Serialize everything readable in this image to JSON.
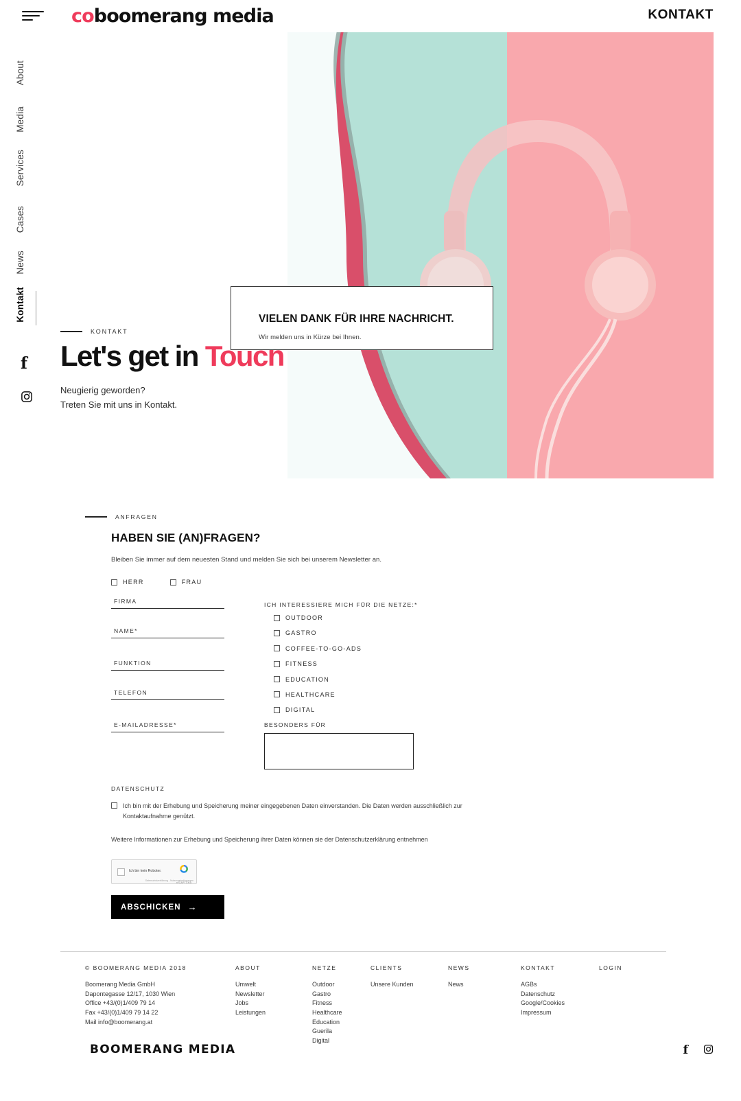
{
  "topbar": {
    "menu_icon": "hamburger-icon",
    "brand": "boomerang media",
    "brand_mark": "co",
    "brand_rest": "boomerang media",
    "right_link": "KONTAKT"
  },
  "rail": {
    "items": [
      {
        "label": "About",
        "active": false
      },
      {
        "label": "Media",
        "active": false
      },
      {
        "label": "Services",
        "active": false
      },
      {
        "label": "Cases",
        "active": false
      },
      {
        "label": "News",
        "active": false
      },
      {
        "label": "Kontakt",
        "active": true
      }
    ],
    "social": [
      {
        "name": "facebook-icon",
        "glyph": "f"
      },
      {
        "name": "instagram-icon",
        "glyph": "instagram"
      }
    ]
  },
  "modal": {
    "title": "VIELEN DANK FÜR IHRE NACHRICHT.",
    "subtitle": "Wir melden uns in Kürze bei Ihnen."
  },
  "hero": {
    "eyebrow": "KONTAKT",
    "headline_black": "Let's get in ",
    "headline_accent": "Touch",
    "sub_line1": "Neugierig geworden?",
    "sub_line2": "Treten Sie mit uns in Kontakt.",
    "image_alt": "headphones-photo"
  },
  "form": {
    "eyebrow": "ANFRAGEN",
    "title": "HABEN SIE (AN)FRAGEN?",
    "description": "Bleiben Sie immer auf dem neuesten Stand und melden Sie sich bei unserem Newsletter an.",
    "salutation": [
      {
        "label": "HERR",
        "checked": false
      },
      {
        "label": "FRAU",
        "checked": false
      }
    ],
    "fields": [
      {
        "label": "FIRMA",
        "value": "",
        "required": false
      },
      {
        "label": "NAME*",
        "value": "",
        "required": true
      },
      {
        "label": "FUNKTION",
        "value": "",
        "required": false
      },
      {
        "label": "TELEFON",
        "value": "",
        "required": false
      },
      {
        "label": "E-MAILADRESSE*",
        "value": "",
        "required": true
      }
    ],
    "netze_label": "ICH INTERESSIERE MICH FÜR DIE NETZE:*",
    "netze": [
      {
        "label": "OUTDOOR",
        "checked": false
      },
      {
        "label": "GASTRO",
        "checked": false
      },
      {
        "label": "COFFEE-TO-GO-ADS",
        "checked": false
      },
      {
        "label": "FITNESS",
        "checked": false
      },
      {
        "label": "EDUCATION",
        "checked": false
      },
      {
        "label": "HEALTHCARE",
        "checked": false
      },
      {
        "label": "DIGITAL",
        "checked": false
      }
    ],
    "besonders_label": "BESONDERS FÜR",
    "besonders_value": "",
    "privacy_title": "DATENSCHUTZ",
    "privacy_consent": "Ich bin mit der Erhebung und Speicherung meiner eingegebenen Daten einverstanden. Die Daten werden ausschließlich zur Kontaktaufnahme genützt.",
    "privacy_note": "Weitere Informationen zur Erhebung und Speicherung ihrer Daten können sie der Datenschutzerklärung entnehmen",
    "recaptcha": {
      "label": "Ich bin kein Roboter.",
      "brand": "reCAPTCHA",
      "fine_print": "Datenschutzerklärung - Nutzungsbedingungen"
    },
    "submit_label": "ABSCHICKEN",
    "submit_arrow": "→"
  },
  "footer": {
    "copyright": "© BOOMERANG MEDIA 2018",
    "address": [
      "Boomerang Media GmbH",
      "Dapontegasse 12/17, 1030 Wien",
      "Office +43/(0)1/409 79 14",
      "Fax +43/(0)1/409 79 14 22",
      "Mail info@boomerang.at"
    ],
    "columns": [
      {
        "head": "ABOUT",
        "links": [
          "Umwelt",
          "Newsletter",
          "Jobs",
          "Leistungen"
        ]
      },
      {
        "head": "NETZE",
        "links": [
          "Outdoor",
          "Gastro",
          "Fitness",
          "Healthcare",
          "Education",
          "Guerila",
          "Digital"
        ]
      },
      {
        "head": "CLIENTS",
        "links": [
          "Unsere Kunden"
        ]
      },
      {
        "head": "NEWS",
        "links": [
          "News"
        ]
      },
      {
        "head": "KONTAKT",
        "links": [
          "AGBs",
          "Datenschutz",
          "Google/Cookies",
          "Impressum"
        ]
      },
      {
        "head": "LOGIN",
        "links": []
      }
    ],
    "logo": "BOOMERANG MEDIA",
    "social": [
      {
        "name": "facebook-icon",
        "glyph": "f"
      },
      {
        "name": "instagram-icon",
        "glyph": "instagram"
      }
    ]
  },
  "colors": {
    "accent_pink": "#ef3b5b",
    "hero_mint": "#b8e3d8",
    "hero_pink": "#f9a8ad",
    "hero_swoosh": "#e0405f",
    "text_dark": "#111111"
  }
}
